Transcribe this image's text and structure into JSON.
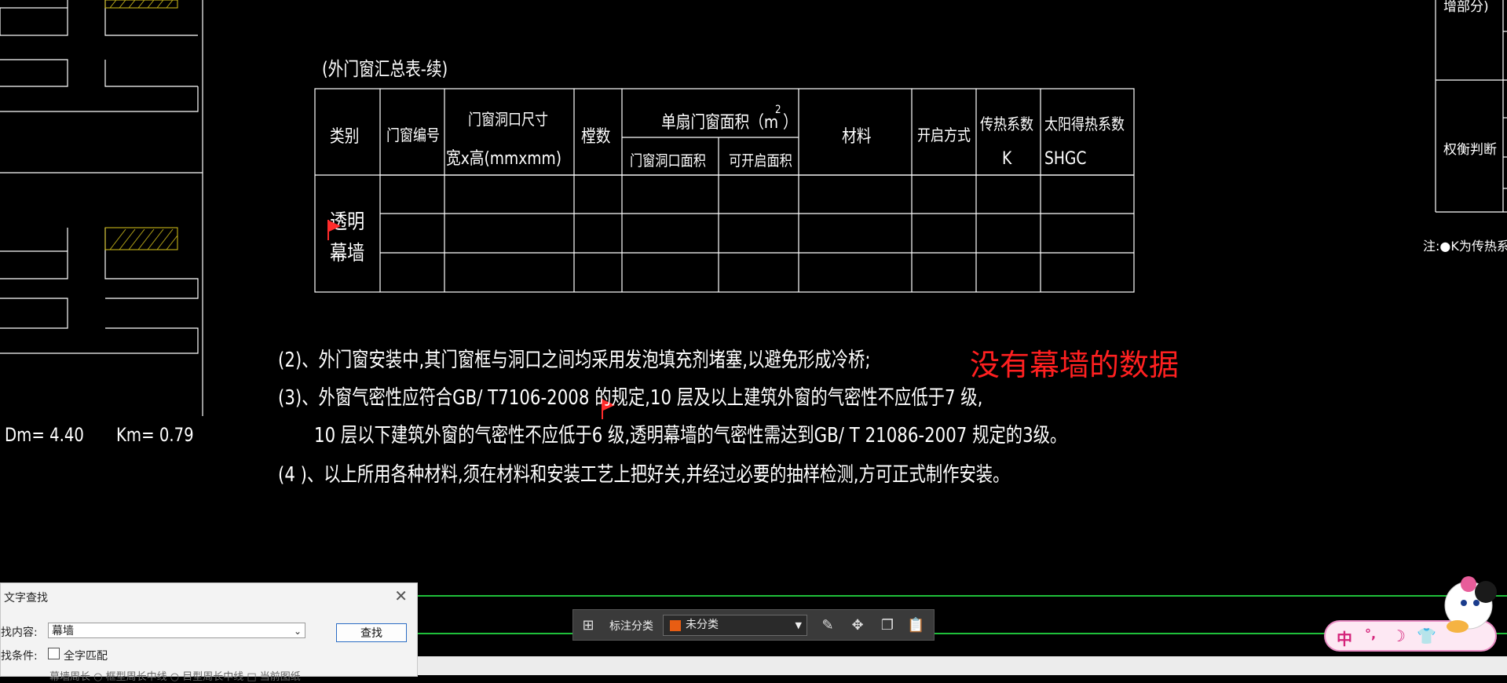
{
  "drawing": {
    "table_title": "(外门窗汇总表-续)",
    "headers": {
      "category": "类别",
      "window_no": "门窗编号",
      "opening_size_1": "门窗洞口尺寸",
      "opening_size_2": "宽x高(mmxmm)",
      "count": "樘数",
      "single_area": "单扇门窗面积（m ）",
      "single_area_sup": "2",
      "opening_area": "门窗洞口面积",
      "openable_area": "可开启面积",
      "material": "材料",
      "open_method": "开启方式",
      "heat_coeff": "传热系数",
      "heat_coeff_sym": "K",
      "solar_coeff": "太阳得热系数",
      "solar_coeff_sym": "SHGC"
    },
    "row_category_1": "透明",
    "row_category_2": "幕墙",
    "notes": [
      "(2)、外门窗安装中,其门窗框与洞口之间均采用发泡填充剂堵塞,以避免形成冷桥;",
      "(3)、外窗气密性应符合GB/ T7106-2008 的规定,10 层及以上建筑外窗的气密性不应低于7 级,",
      "10 层以下建筑外窗的气密性不应低于6 级,透明幕墙的气密性需达到GB/ T 21086-2007 规定的3级。",
      "(4 )、以上所用各种材料,须在材料和安装工艺上把好关,并经过必要的抽样检测,方可正式制作安装。"
    ],
    "annotation": "没有幕墙的数据",
    "left_dm": "Dm= 4.40",
    "left_km": "Km= 0.79",
    "right_label_top": "增部分)",
    "right_label_mid": "权衡判断",
    "right_note": "注:●K为传热系数["
  },
  "dialog": {
    "title": "文字查找",
    "search_label": "找内容:",
    "search_value": "幕墙",
    "find_button": "查找",
    "condition_label": "找条件:",
    "full_match": "全字匹配",
    "bottom_partial": "幕墙周长   ○ 框型周长中线   ○ 目型周长中线   □ 当前图纸"
  },
  "toolbar": {
    "label": "标注分类",
    "selected": "未分类"
  },
  "ime": {
    "mode": "中"
  }
}
